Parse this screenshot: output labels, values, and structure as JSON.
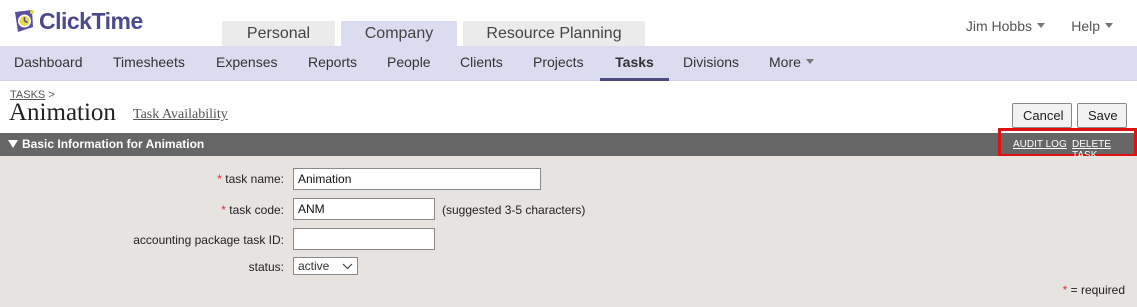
{
  "app": {
    "logo_text": "ClickTime"
  },
  "top_tabs": [
    {
      "label": "Personal"
    },
    {
      "label": "Company"
    },
    {
      "label": "Resource Planning"
    }
  ],
  "user_menu": {
    "label": "Jim Hobbs"
  },
  "help_menu": {
    "label": "Help"
  },
  "subnav": {
    "items": [
      {
        "label": "Dashboard"
      },
      {
        "label": "Timesheets"
      },
      {
        "label": "Expenses"
      },
      {
        "label": "Reports"
      },
      {
        "label": "People"
      },
      {
        "label": "Clients"
      },
      {
        "label": "Projects"
      },
      {
        "label": "Tasks"
      },
      {
        "label": "Divisions"
      },
      {
        "label": "More"
      }
    ],
    "active": "Tasks"
  },
  "breadcrumb": {
    "link": "TASKS",
    "separator": ">"
  },
  "page": {
    "title": "Animation",
    "subtitle_link": "Task Availability"
  },
  "buttons": {
    "cancel": "Cancel",
    "save": "Save"
  },
  "section": {
    "title": "Basic Information for Animation",
    "links": {
      "audit_log": "AUDIT LOG",
      "delete_task": "DELETE TASK"
    }
  },
  "form": {
    "required_marker": "*",
    "task_name": {
      "label": "task name:",
      "value": "Animation"
    },
    "task_code": {
      "label": "task code:",
      "value": "ANM",
      "hint": "(suggested 3-5 characters)"
    },
    "accounting_id": {
      "label": "accounting package task ID:",
      "value": ""
    },
    "status": {
      "label": "status:",
      "value": "active"
    },
    "required_note": "= required"
  },
  "colors": {
    "brand": "#4b4a8c",
    "nav_bg": "#dcdcf0",
    "section_bar": "#666666",
    "form_bg": "#e7e3e0",
    "highlight": "#e01010",
    "required": "#e03030"
  }
}
